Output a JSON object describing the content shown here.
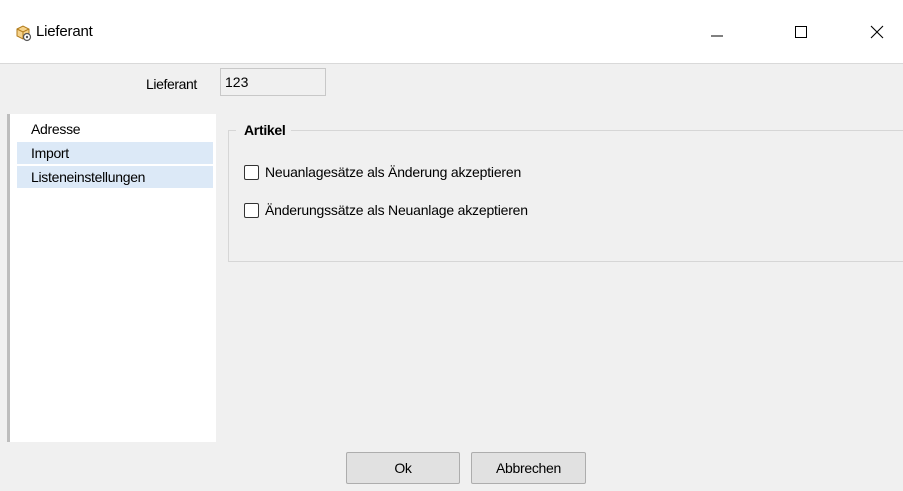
{
  "window": {
    "title": "Lieferant",
    "icon": "supplier-gear-icon",
    "controls": [
      "minimize-icon",
      "maximize-icon",
      "close-icon"
    ]
  },
  "header": {
    "label": "Lieferant",
    "value": "123"
  },
  "nav": {
    "items": [
      {
        "label": "Adresse"
      },
      {
        "label": "Import"
      },
      {
        "label": "Listeneinstellungen"
      }
    ],
    "selected": [
      "Import",
      "Listeneinstellungen"
    ]
  },
  "group": {
    "title": "Artikel",
    "options": [
      {
        "label": "Neuanlagesätze als Änderung akzeptieren",
        "checked": false
      },
      {
        "label": "Änderungssätze als Neuanlage akzeptieren",
        "checked": false
      }
    ]
  },
  "buttons": {
    "ok": "Ok",
    "cancel": "Abbrechen"
  },
  "colors": {
    "selection": "#dce9f7",
    "window_bg": "#f0f0f0",
    "titlebar_bg": "#ffffff"
  }
}
